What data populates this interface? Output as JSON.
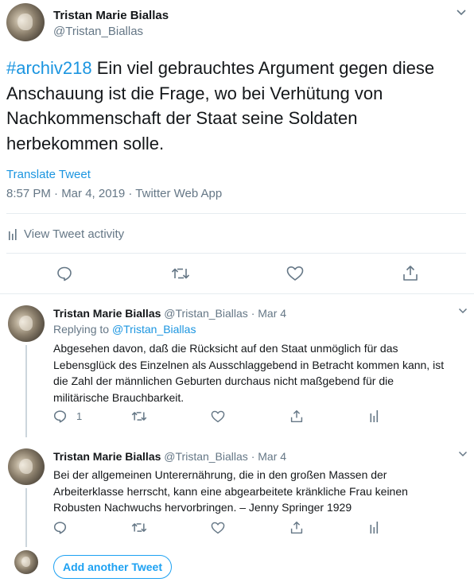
{
  "main_tweet": {
    "author_name": "Tristan Marie Biallas",
    "author_handle": "@Tristan_Biallas",
    "hashtag": "#archiv218",
    "text_line1": " Ein viel gebrauchtes Argument gegen diese",
    "text_line2": "Anschauung ist die Frage, wo bei Verhütung von",
    "text_line3": "Nachkommenschaft der Staat seine Soldaten",
    "text_line4": "herbekommen solle.",
    "translate_label": "Translate Tweet",
    "meta": "8:57 PM · Mar 4, 2019 · Twitter Web App",
    "activity_label": "View Tweet activity"
  },
  "replies": [
    {
      "author_name": "Tristan Marie Biallas",
      "author_handle": "@Tristan_Biallas",
      "date": "· Mar 4",
      "replying_prefix": "Replying to ",
      "replying_handle": "@Tristan_Biallas",
      "line1": "Abgesehen davon, daß die Rücksicht auf den Staat unmöglich für das",
      "line2": "Lebensglück des Einzelnen als Ausschlaggebend in Betracht kommen kann, ist",
      "line3": "die Zahl der männlichen Geburten durchaus nicht maßgebend für die",
      "line4": "militärische Brauchbarkeit.",
      "reply_count": "1"
    },
    {
      "author_name": "Tristan Marie Biallas",
      "author_handle": "@Tristan_Biallas",
      "date": "· Mar 4",
      "line1": "Bei der allgemeinen Unterernährung, die in den großen Massen der",
      "line2": "Arbeiterklasse herrscht, kann eine abgearbeitete kränkliche Frau keinen",
      "line3": "Robusten Nachwuchs hervorbringen. – Jenny Springer 1929"
    }
  ],
  "add_another_label": "Add another Tweet",
  "icons": [
    "chevron-down-icon",
    "reply-icon",
    "retweet-icon",
    "like-icon",
    "share-icon",
    "analytics-icon"
  ],
  "colors": {
    "link": "#1b95e0",
    "secondary_text": "#657786",
    "button": "#1da1f2"
  }
}
